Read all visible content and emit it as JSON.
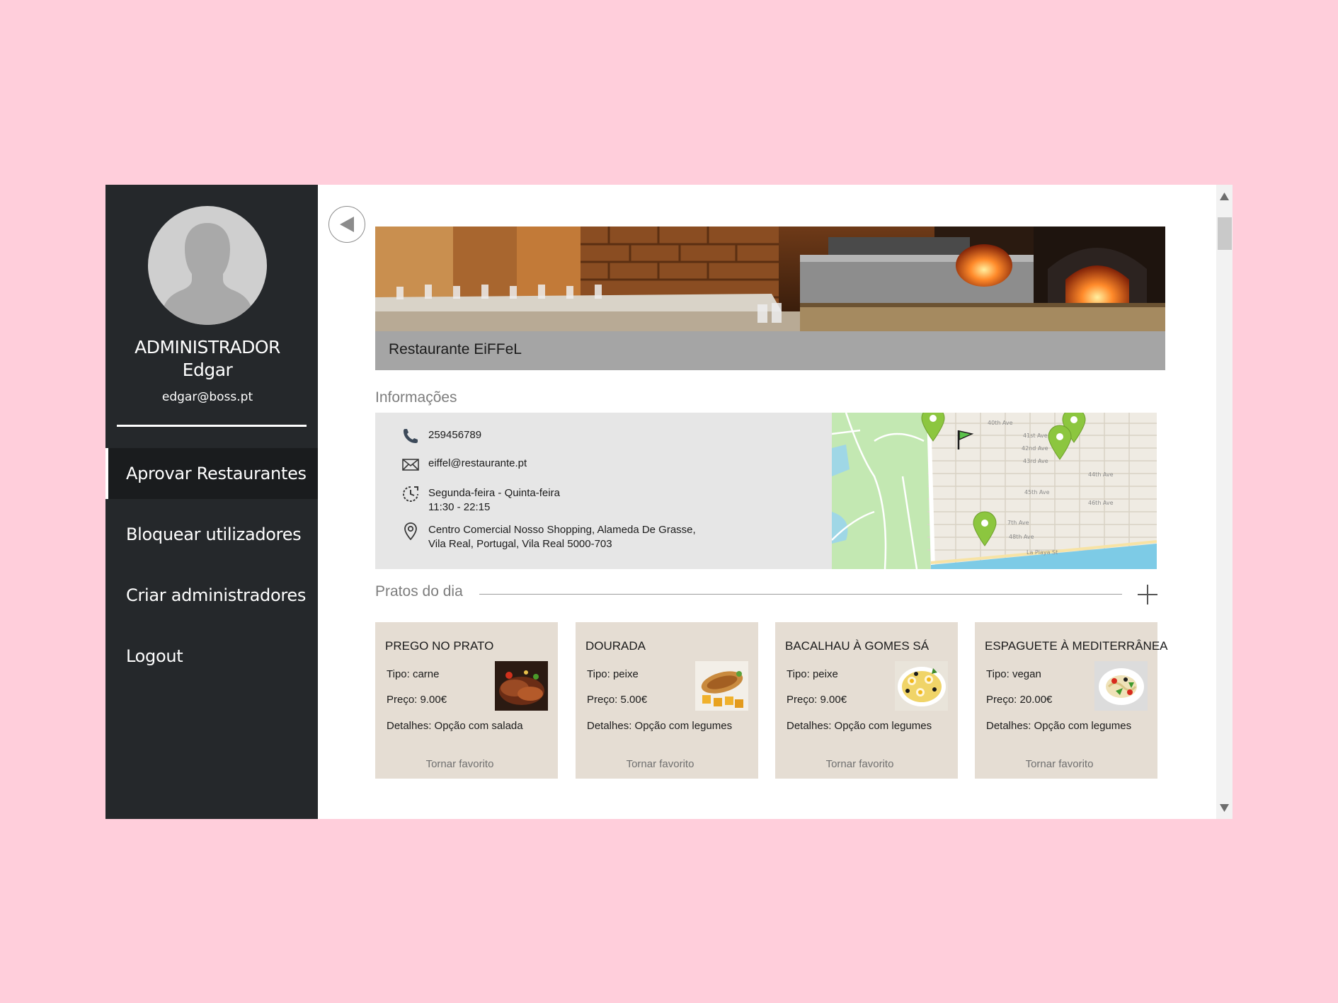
{
  "profile": {
    "role": "ADMINISTRADOR",
    "name": "Edgar",
    "email": "edgar@boss.pt"
  },
  "menu": {
    "items": [
      {
        "label": "Aprovar Restaurantes",
        "active": true
      },
      {
        "label": "Bloquear utilizadores",
        "active": false
      },
      {
        "label": "Criar administradores",
        "active": false
      },
      {
        "label": "Logout",
        "active": false
      }
    ]
  },
  "restaurant": {
    "name": "Restaurante EiFFeL"
  },
  "info": {
    "section_title": "Informações",
    "phone": "259456789",
    "email": "eiffel@restaurante.pt",
    "days": "Segunda-feira - Quinta-feira",
    "hours": "11:30 - 22:15",
    "address_line1": "Centro Comercial Nosso Shopping, Alameda De Grasse,",
    "address_line2": "Vila Real, Portugal, Vila Real 5000-703"
  },
  "map": {
    "streets": [
      "40th Ave",
      "41st Ave",
      "42nd Ave",
      "43rd Ave",
      "44th Ave",
      "45th Ave",
      "46th Ave",
      "7th Ave",
      "48th Ave",
      "La Playa St"
    ]
  },
  "dishes": {
    "section_title": "Pratos do dia",
    "items": [
      {
        "name": "PREGO NO PRATO",
        "type": "Tipo: carne",
        "price": "Preço: 9.00€",
        "details": "Detalhes: Opção com salada",
        "fav": "Tornar favorito"
      },
      {
        "name": "DOURADA",
        "type": "Tipo: peixe",
        "price": "Preço: 5.00€",
        "details": "Detalhes: Opção com legumes",
        "fav": "Tornar favorito"
      },
      {
        "name": "BACALHAU À GOMES SÁ",
        "type": "Tipo: peixe",
        "price": "Preço: 9.00€",
        "details": "Detalhes: Opção com legumes",
        "fav": "Tornar favorito"
      },
      {
        "name": "ESPAGUETE À MEDITERRÂNEA",
        "type": "Tipo: vegan",
        "price": "Preço: 20.00€",
        "details": "Detalhes: Opção com legumes",
        "fav": "Tornar favorito"
      }
    ]
  },
  "colors": {
    "sidebar": "#25282b",
    "background": "#ffcedb",
    "card": "#e5ddd3",
    "pin": "#8cc63f"
  }
}
